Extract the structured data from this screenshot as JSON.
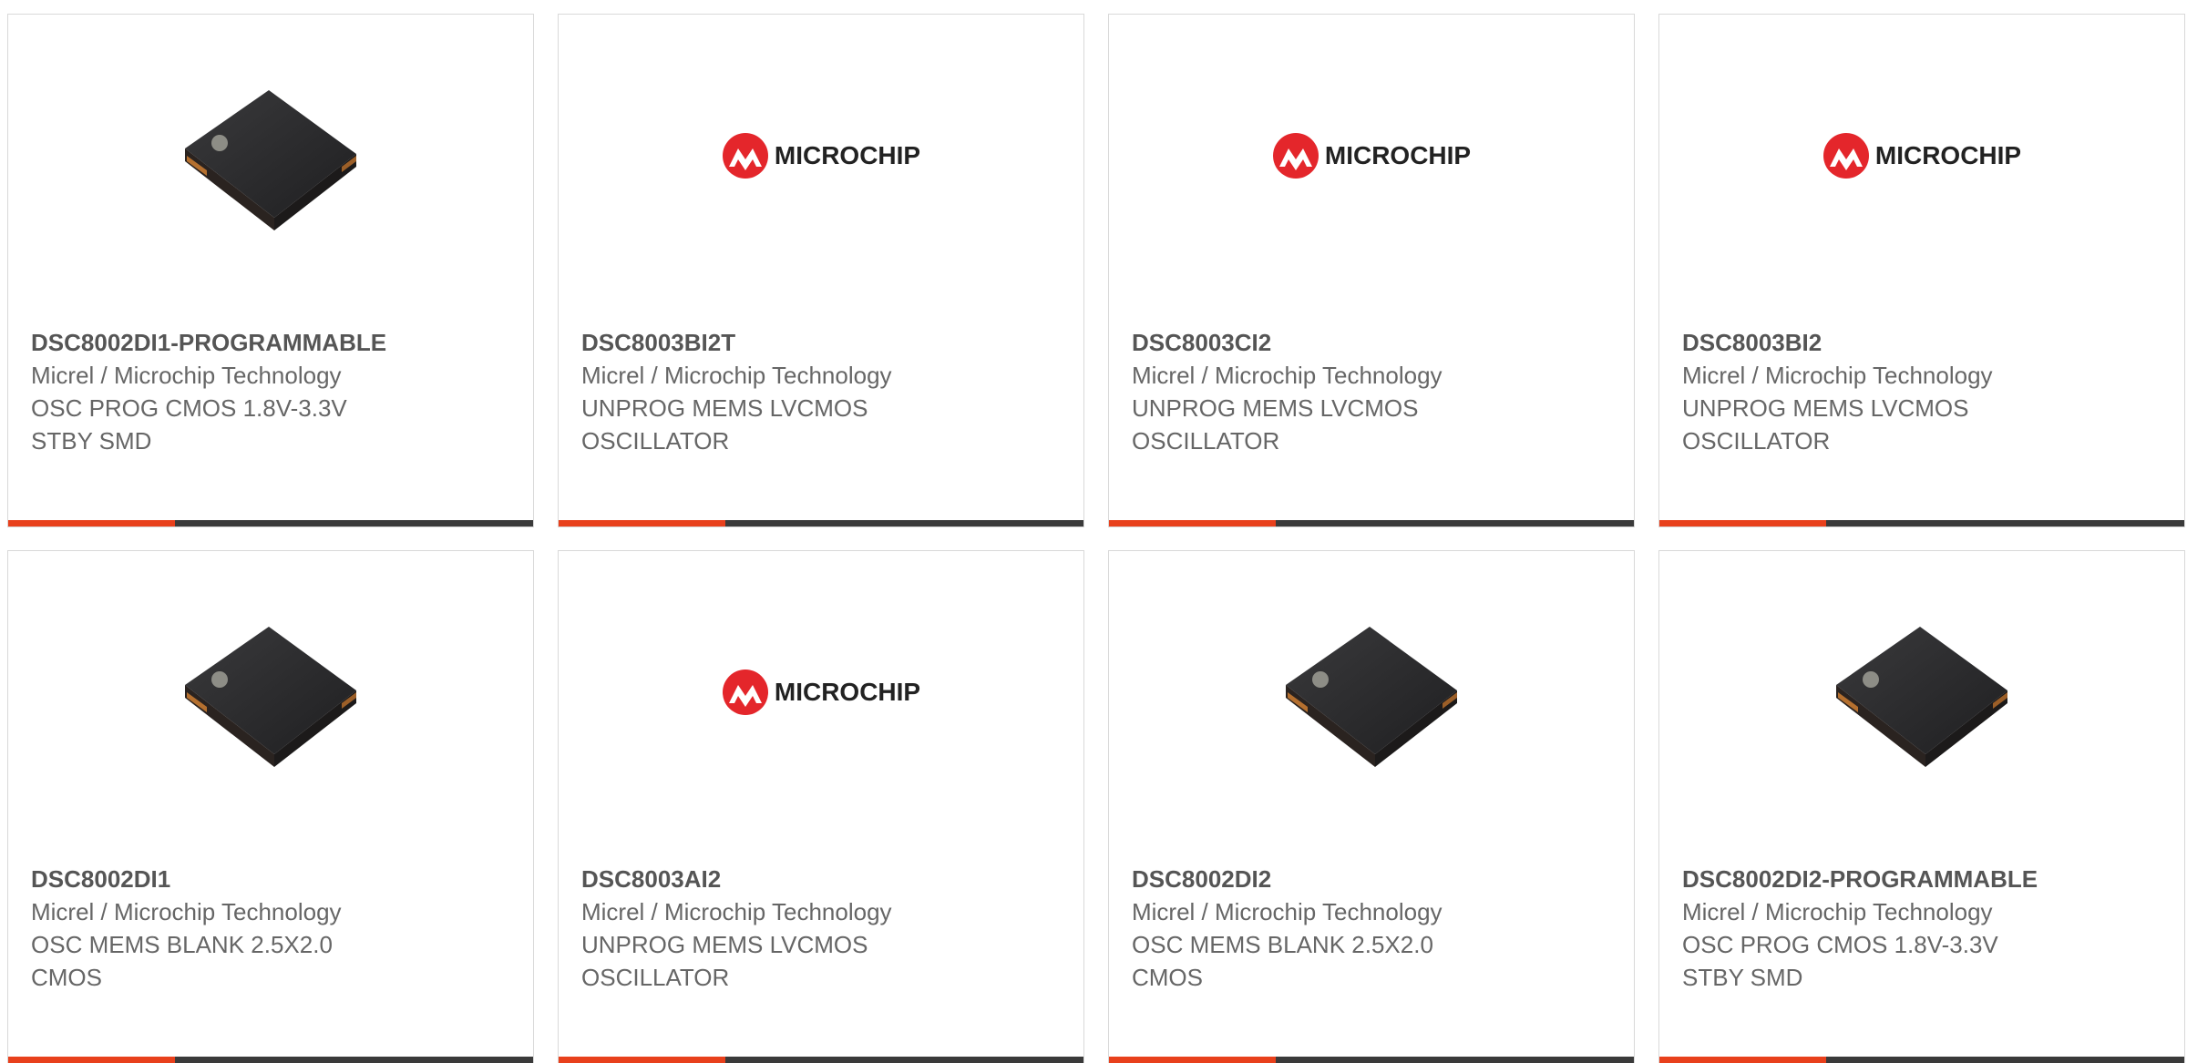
{
  "colors": {
    "accent": "#e8401c",
    "bar_dark": "#3a3a3a",
    "logo_red": "#e4262b",
    "text": "#666666"
  },
  "products": [
    {
      "part_number": "DSC8002DI1-PROGRAMMABLE",
      "manufacturer": "Micrel / Microchip Technology",
      "description": "OSC PROG CMOS 1.8V-3.3V STBY SMD",
      "image": "chip-photo"
    },
    {
      "part_number": "DSC8003BI2T",
      "manufacturer": "Micrel / Microchip Technology",
      "description": "UNPROG MEMS LVCMOS OSCILLATOR",
      "image": "microchip-logo"
    },
    {
      "part_number": "DSC8003CI2",
      "manufacturer": "Micrel / Microchip Technology",
      "description": "UNPROG MEMS LVCMOS OSCILLATOR",
      "image": "microchip-logo"
    },
    {
      "part_number": "DSC8003BI2",
      "manufacturer": "Micrel / Microchip Technology",
      "description": "UNPROG MEMS LVCMOS OSCILLATOR",
      "image": "microchip-logo"
    },
    {
      "part_number": "DSC8002DI1",
      "manufacturer": "Micrel / Microchip Technology",
      "description": "OSC MEMS BLANK 2.5X2.0 CMOS",
      "image": "chip-photo"
    },
    {
      "part_number": "DSC8003AI2",
      "manufacturer": "Micrel / Microchip Technology",
      "description": "UNPROG MEMS LVCMOS OSCILLATOR",
      "image": "microchip-logo"
    },
    {
      "part_number": "DSC8002DI2",
      "manufacturer": "Micrel / Microchip Technology",
      "description": "OSC MEMS BLANK 2.5X2.0 CMOS",
      "image": "chip-photo"
    },
    {
      "part_number": "DSC8002DI2-PROGRAMMABLE",
      "manufacturer": "Micrel / Microchip Technology",
      "description": "OSC PROG CMOS 1.8V-3.3V STBY SMD",
      "image": "chip-photo"
    }
  ],
  "logo": {
    "wordmark": "MICROCHIP"
  }
}
